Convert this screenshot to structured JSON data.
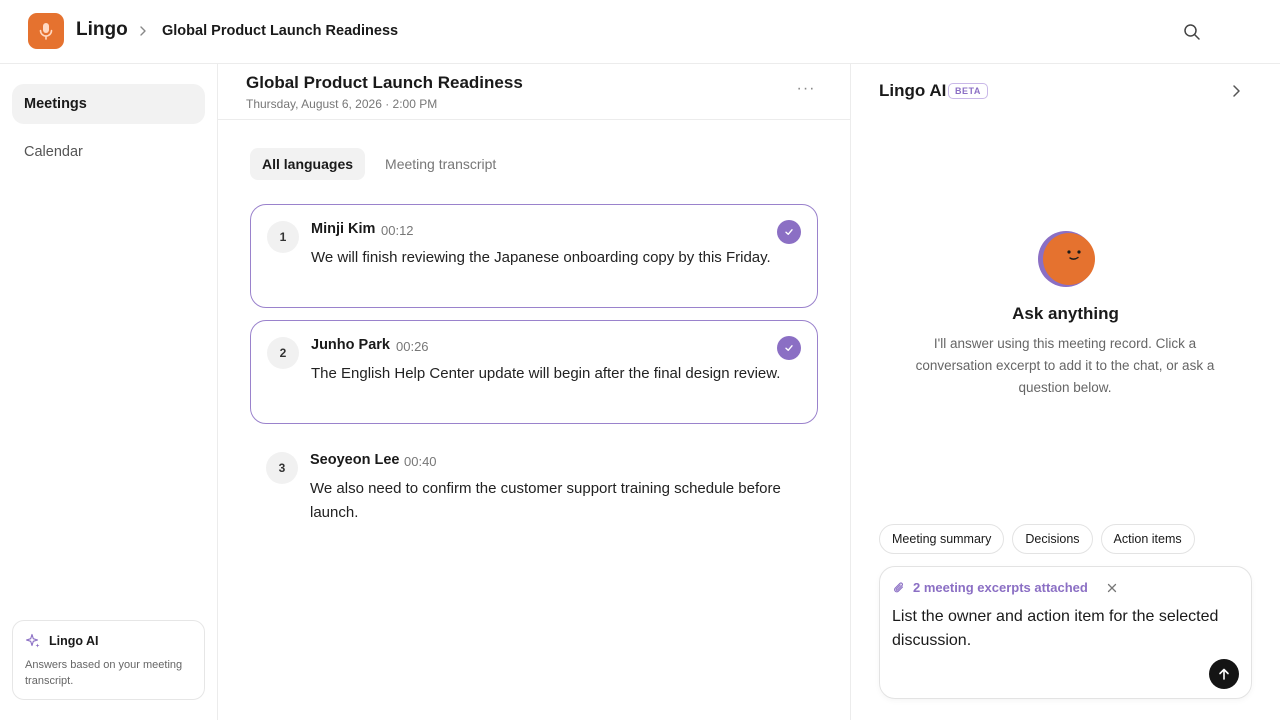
{
  "app": {
    "name": "Lingo",
    "logo_icon": "mic-icon",
    "accent": "#e5722f"
  },
  "breadcrumb": {
    "title": "Global Product Launch Readiness"
  },
  "sidebar": {
    "items": [
      {
        "label": "Meetings",
        "active": true
      },
      {
        "label": "Calendar",
        "active": false
      }
    ],
    "ai_card": {
      "title": "Lingo AI",
      "description": "Answers based on your meeting transcript."
    }
  },
  "meeting": {
    "title": "Global Product Launch Readiness",
    "date": "Thursday, August 6, 2026 · 2:00 PM",
    "more": "···"
  },
  "tabs": [
    {
      "label": "All languages",
      "active": true
    },
    {
      "label": "Meeting transcript",
      "active": false
    }
  ],
  "excerpts": [
    {
      "num": "1",
      "speaker": "Minji Kim",
      "time": "00:12",
      "text": "We will finish reviewing the Japanese onboarding copy by this Friday.",
      "selected": true
    },
    {
      "num": "2",
      "speaker": "Junho Park",
      "time": "00:26",
      "text": "The English Help Center update will begin after the final design review.",
      "selected": true
    },
    {
      "num": "3",
      "speaker": "Seoyeon Lee",
      "time": "00:40",
      "text": "We also need to confirm the customer support training schedule before launch.",
      "selected": false
    }
  ],
  "ai_panel": {
    "title": "Lingo AI",
    "badge": "BETA",
    "ask_title": "Ask anything",
    "ask_desc": "I'll answer using this meeting record. Click a conversation excerpt to add it to the chat, or ask a question below.",
    "chips": [
      "Meeting summary",
      "Decisions",
      "Action items"
    ],
    "attachment": "2 meeting excerpts attached",
    "input_value": "List the owner and action item for the selected discussion.",
    "selection_color": "#8b6fc4"
  }
}
